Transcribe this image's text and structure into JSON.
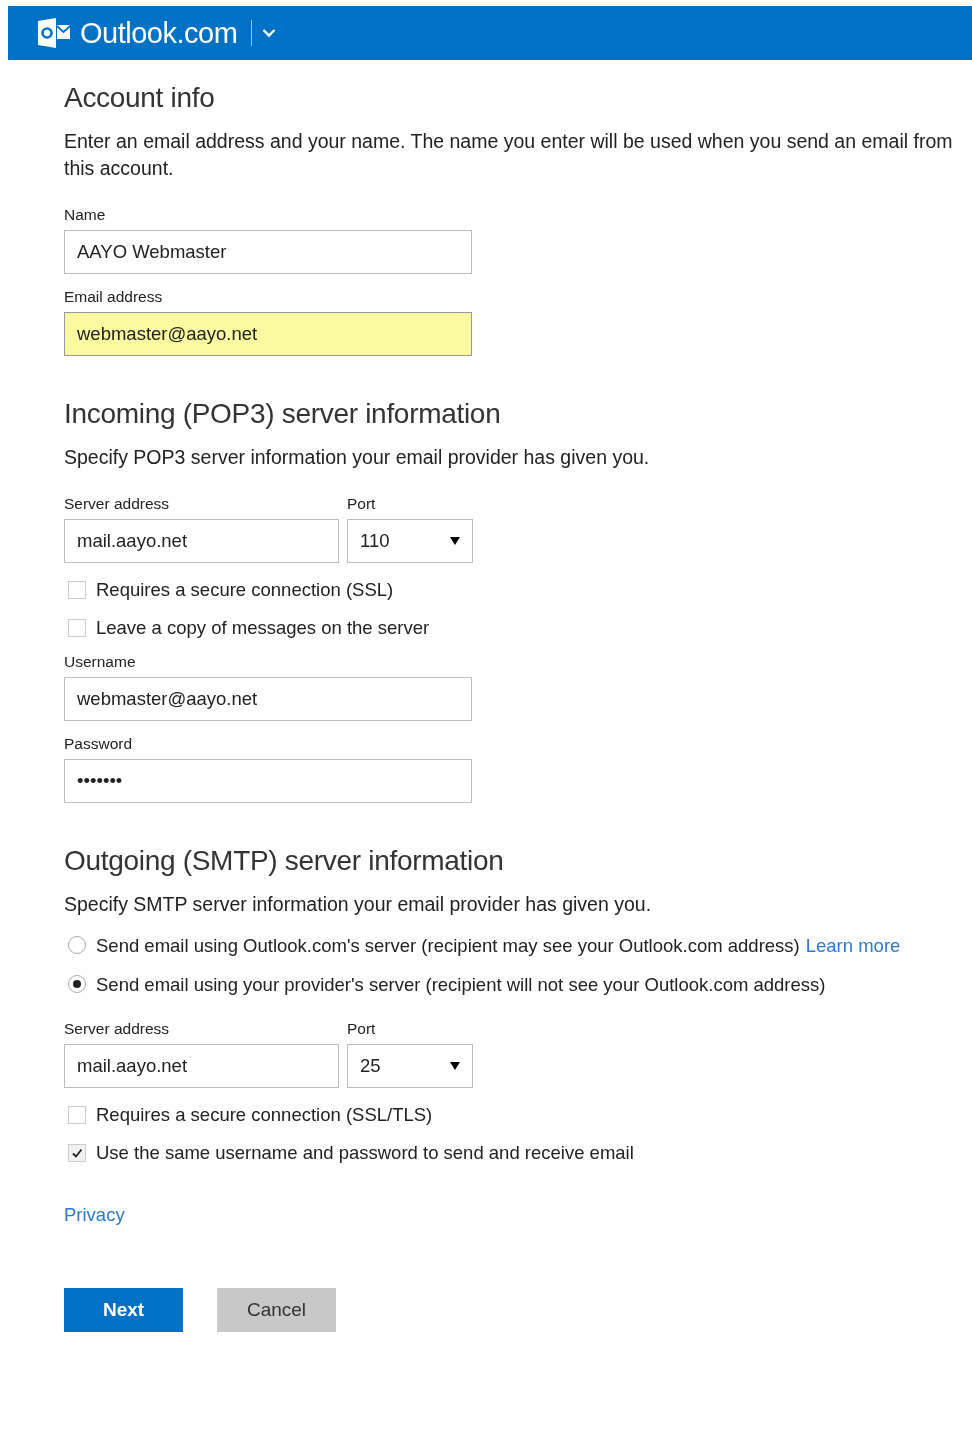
{
  "header": {
    "title": "Outlook.com"
  },
  "sections": [
    {
      "heading": "Account info",
      "description": "Enter an email address and your name. The name you enter will be used when you send an email from this account.",
      "items": [
        {
          "kind": "field",
          "label": "Name",
          "value": "AAYO Webmaster",
          "highlighted": false
        },
        {
          "kind": "field",
          "label": "Email address",
          "value": "webmaster@aayo.net",
          "highlighted": true
        }
      ]
    },
    {
      "heading": "Incoming (POP3) server information",
      "description": "Specify POP3 server information your email provider has given you.",
      "items": [
        {
          "kind": "server",
          "label": "Server address",
          "value": "mail.aayo.net",
          "port_label": "Port",
          "port": "110"
        },
        {
          "kind": "checkbox",
          "label": "Requires a secure connection (SSL)",
          "checked": false
        },
        {
          "kind": "checkbox",
          "label": "Leave a copy of messages on the server",
          "checked": false
        },
        {
          "kind": "field",
          "label": "Username",
          "value": "webmaster@aayo.net",
          "highlighted": false
        },
        {
          "kind": "field",
          "label": "Password",
          "value": "•••••••",
          "highlighted": false
        }
      ]
    },
    {
      "heading": "Outgoing (SMTP) server information",
      "description": "Specify SMTP server information your email provider has given you.",
      "items": [
        {
          "kind": "radio",
          "label": "Send email using Outlook.com's server (recipient may see your Outlook.com address)",
          "link": "Learn more",
          "selected": false
        },
        {
          "kind": "radio",
          "label": "Send email using your provider's server (recipient will not see your Outlook.com address)",
          "selected": true
        },
        {
          "kind": "server",
          "label": "Server address",
          "value": "mail.aayo.net",
          "port_label": "Port",
          "port": "25"
        },
        {
          "kind": "checkbox",
          "label": "Requires a secure connection (SSL/TLS)",
          "checked": false
        },
        {
          "kind": "checkbox",
          "label": "Use the same username and password to send and receive email",
          "checked": true
        }
      ]
    }
  ],
  "privacy_link": "Privacy",
  "buttons": [
    {
      "label": "Next",
      "kind": "primary"
    },
    {
      "label": "Cancel",
      "kind": "secondary"
    }
  ]
}
